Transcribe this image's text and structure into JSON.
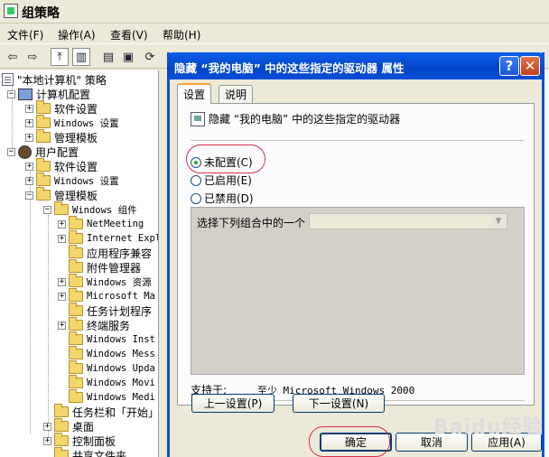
{
  "window": {
    "title": "组策略"
  },
  "menu": [
    "文件(F)",
    "操作(A)",
    "查看(V)",
    "帮助(H)"
  ],
  "toolbar": {
    "icons": [
      "back-arrow-icon",
      "forward-arrow-icon",
      "up-folder-icon",
      "show-tree-icon",
      "properties-icon",
      "export-icon",
      "refresh-icon",
      "help-icon"
    ]
  },
  "tree": {
    "root": "\"本地计算机\" 策略",
    "computer_config": "计算机配置",
    "software_settings": "软件设置",
    "windows_settings": "Windows 设置",
    "admin_templates": "管理模板",
    "user_config": "用户配置",
    "windows_components": "Windows 组件",
    "items": [
      "NetMeeting",
      "Internet Expl",
      "应用程序兼容",
      "附件管理器",
      "Windows 资源",
      "Microsoft Ma",
      "任务计划程序",
      "终端服务",
      "Windows Inst",
      "Windows Mess",
      "Windows Upda",
      "Windows Movi",
      "Windows Medi"
    ],
    "taskbar": "任务栏和「开始」",
    "desktop": "桌面",
    "control_panel": "控制面板",
    "shared_folders": "共享文件夹"
  },
  "dialog": {
    "title": "隐藏 “我的电脑” 中的这些指定的驱动器 属性",
    "help_glyph": "?",
    "close_glyph": "✕",
    "tabs": [
      "设置",
      "说明"
    ],
    "policy_name": "隐藏 “我的电脑” 中的这些指定的驱动器",
    "radios": [
      "未配置(C)",
      "已启用(E)",
      "已禁用(D)"
    ],
    "selected_radio": 0,
    "combo_label": "选择下列组合中的一个",
    "supported_label": "支持于:",
    "supported_value": "至少 Microsoft Windows 2000",
    "prev_button": "上一设置(P)",
    "next_button": "下一设置(N)",
    "ok_button": "确定",
    "cancel_button": "取消",
    "apply_button": "应用(A)"
  },
  "watermark": "Baidu经验"
}
